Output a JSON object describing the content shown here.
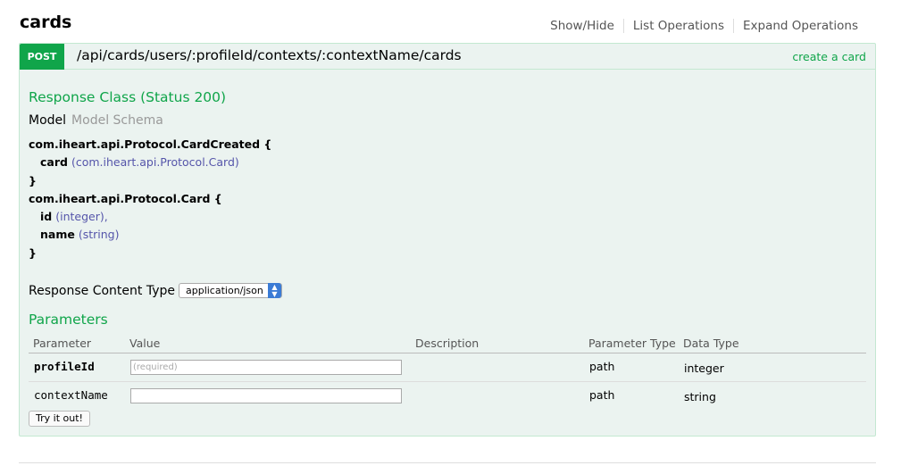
{
  "resource": {
    "title": "cards",
    "actions": [
      "Show/Hide",
      "List Operations",
      "Expand Operations"
    ]
  },
  "operation": {
    "method": "POST",
    "path": "/api/cards/users/:profileId/contexts/:contextName/cards",
    "summary": "create a card",
    "response_class": {
      "title": "Response Class (Status 200)",
      "tabs": {
        "model": "Model",
        "schema": "Model Schema"
      },
      "signature": {
        "class1": "com.iheart.api.Protocol.CardCreated {",
        "class1_field1_name": "card",
        "class1_field1_type": "(com.iheart.api.Protocol.Card)",
        "class1_close": "}",
        "class2": "com.iheart.api.Protocol.Card {",
        "class2_field1_name": "id",
        "class2_field1_type": "(integer),",
        "class2_field2_name": "name",
        "class2_field2_type": "(string)",
        "class2_close": "}"
      }
    },
    "response_content_type": {
      "label": "Response Content Type",
      "selected": "application/json"
    },
    "parameters": {
      "title": "Parameters",
      "columns": {
        "parameter": "Parameter",
        "value": "Value",
        "description": "Description",
        "parameter_type": "Parameter Type",
        "data_type": "Data Type"
      },
      "rows": [
        {
          "name": "profileId",
          "placeholder": "(required)",
          "value": "",
          "param_type": "path",
          "data_type": "integer"
        },
        {
          "name": "contextName",
          "placeholder": "",
          "value": "",
          "param_type": "path",
          "data_type": "string"
        }
      ]
    },
    "try_button": "Try it out!"
  },
  "colors": {
    "accent_green": "#10a54a",
    "panel_bg": "#ebf3f0",
    "panel_border": "#c3e8d1",
    "type_blue": "#5555aa"
  }
}
